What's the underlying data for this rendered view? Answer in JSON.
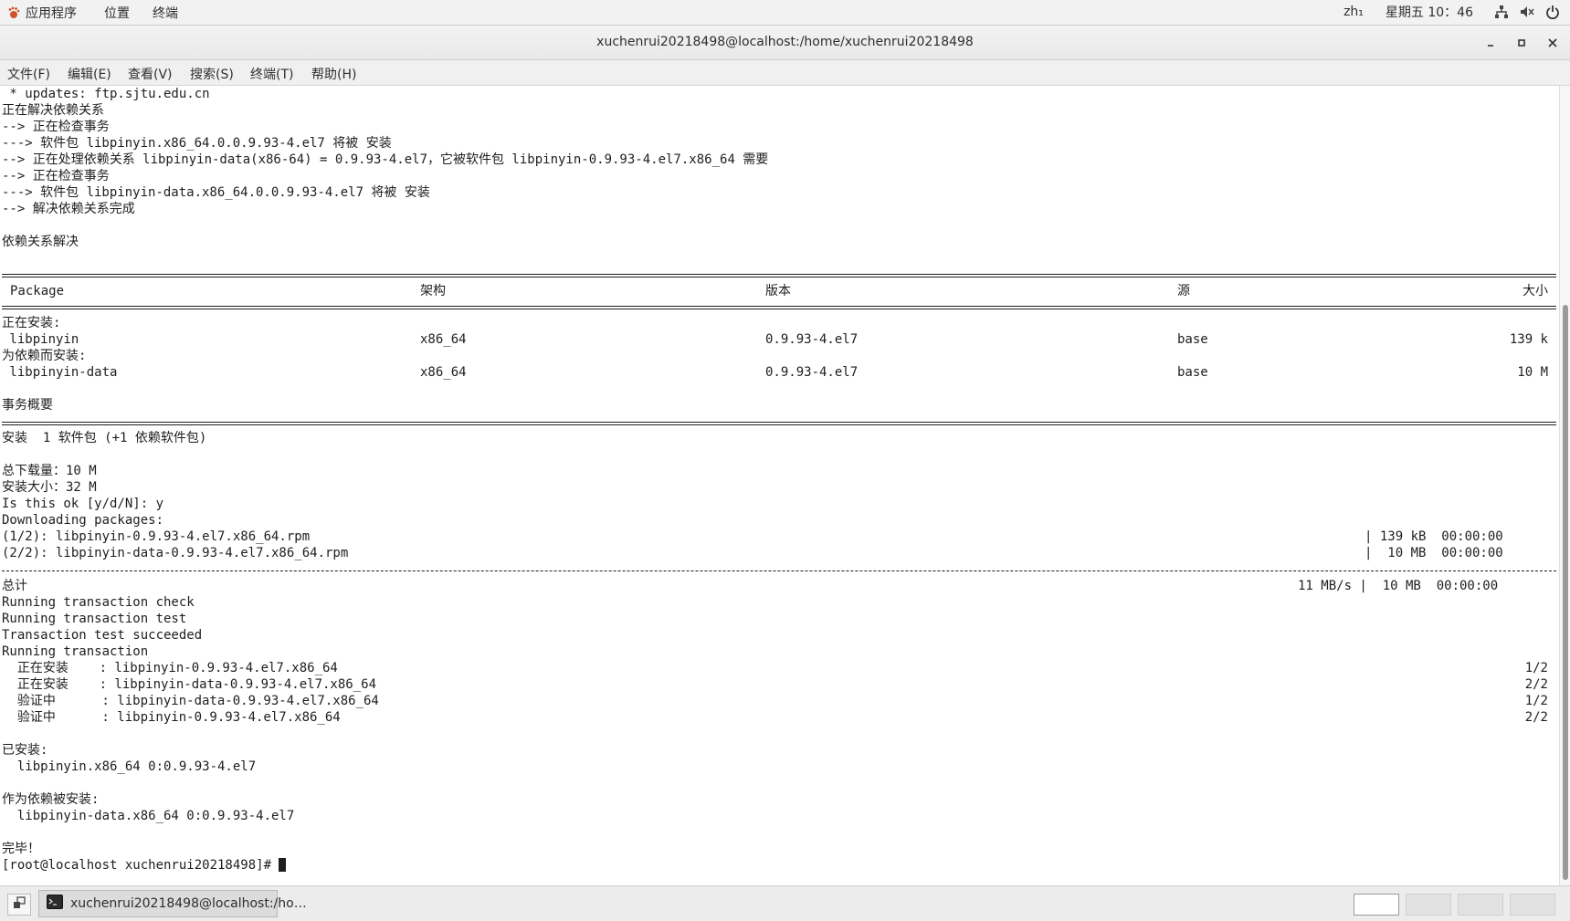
{
  "top_panel": {
    "applications": "应用程序",
    "places": "位置",
    "terminal": "终端",
    "input_method": "zh₁",
    "clock": "星期五 10：46"
  },
  "window": {
    "title": "xuchenrui20218498@localhost:/home/xuchenrui20218498"
  },
  "menubar": {
    "file": "文件(F)",
    "edit": "编辑(E)",
    "view": "查看(V)",
    "search": "搜索(S)",
    "terminal": "终端(T)",
    "help": "帮助(H)"
  },
  "terminal": {
    "head_lines": [
      " * updates: ftp.sjtu.edu.cn",
      "正在解决依赖关系",
      "--> 正在检查事务",
      "---> 软件包 libpinyin.x86_64.0.0.9.93-4.el7 将被 安装",
      "--> 正在处理依赖关系 libpinyin-data(x86-64) = 0.9.93-4.el7，它被软件包 libpinyin-0.9.93-4.el7.x86_64 需要",
      "--> 正在检查事务",
      "---> 软件包 libpinyin-data.x86_64.0.0.9.93-4.el7 将被 安装",
      "--> 解决依赖关系完成",
      "",
      "依赖关系解决"
    ],
    "table_headers": {
      "package": "Package",
      "arch": "架构",
      "version": "版本",
      "repo": "源",
      "size": "大小"
    },
    "installing_label": "正在安装:",
    "dep_label": "为依赖而安装:",
    "rows": [
      {
        "name": " libpinyin",
        "arch": "x86_64",
        "version": "0.9.93-4.el7",
        "repo": "base",
        "size": "139 k"
      },
      {
        "name": " libpinyin-data",
        "arch": "x86_64",
        "version": "0.9.93-4.el7",
        "repo": "base",
        "size": "10 M"
      }
    ],
    "summary_label": "事务概要",
    "install_summary": "安装  1 软件包 (+1 依赖软件包)",
    "total_download": "总下载量：10 M",
    "install_size": "安装大小：32 M",
    "prompt_ok": "Is this ok [y/d/N]: y",
    "downloading": "Downloading packages:",
    "downloads": [
      {
        "file": "(1/2): libpinyin-0.9.93-4.el7.x86_64.rpm",
        "stats": "| 139 kB  00:00:00"
      },
      {
        "file": "(2/2): libpinyin-data-0.9.93-4.el7.x86_64.rpm",
        "stats": "|  10 MB  00:00:00"
      }
    ],
    "total_label": "总计",
    "total_stats": "11 MB/s |  10 MB  00:00:00",
    "tx_lines": [
      "Running transaction check",
      "Running transaction test",
      "Transaction test succeeded",
      "Running transaction"
    ],
    "tx_steps": [
      {
        "text": "  正在安装    : libpinyin-0.9.93-4.el7.x86_64",
        "count": "1/2"
      },
      {
        "text": "  正在安装    : libpinyin-data-0.9.93-4.el7.x86_64",
        "count": "2/2"
      },
      {
        "text": "  验证中      : libpinyin-data-0.9.93-4.el7.x86_64",
        "count": "1/2"
      },
      {
        "text": "  验证中      : libpinyin-0.9.93-4.el7.x86_64",
        "count": "2/2"
      }
    ],
    "installed_label": "已安装:",
    "installed_pkg": "  libpinyin.x86_64 0:0.9.93-4.el7",
    "dep_installed_label": "作为依赖被安装:",
    "dep_installed_pkg": "  libpinyin-data.x86_64 0:0.9.93-4.el7",
    "done": "完毕！",
    "prompt": "[root@localhost xuchenrui20218498]# "
  },
  "taskbar": {
    "task_label": "xuchenrui20218498@localhost:/ho…"
  },
  "icons": {
    "apps": "gnome-foot-icon",
    "network": "network-icon",
    "volume": "volume-icon",
    "power": "power-icon",
    "minimize": "minimize-icon",
    "maximize": "maximize-icon",
    "close": "close-icon",
    "show_desktop": "show-desktop-icon",
    "terminal_app": "terminal-icon"
  }
}
